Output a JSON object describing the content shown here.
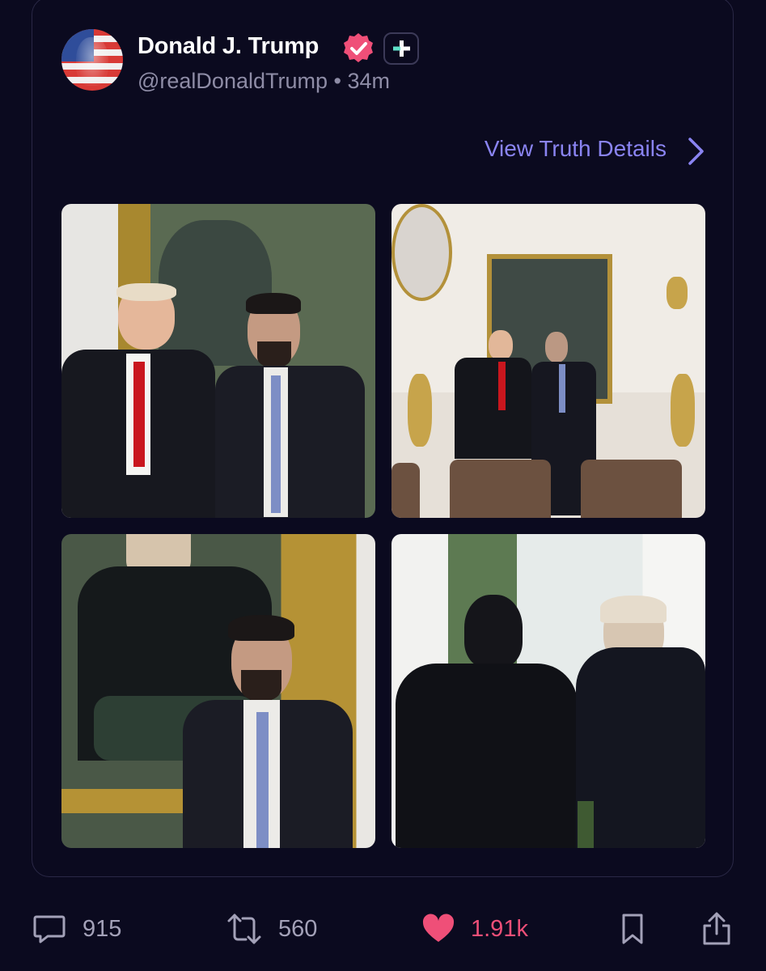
{
  "post": {
    "author_name": "Donald J. Trump",
    "handle": "@realDonaldTrump",
    "separator": "•",
    "time": "34m",
    "view_details_label": "View Truth Details"
  },
  "colors": {
    "background": "#0b0a1f",
    "accent": "#8a84f2",
    "verified": "#ef4f78",
    "like": "#ef4f78",
    "muted": "#a3a1b8"
  },
  "media": [
    {
      "kind": "photo"
    },
    {
      "kind": "photo"
    },
    {
      "kind": "photo"
    },
    {
      "kind": "photo"
    }
  ],
  "actions": {
    "replies": "915",
    "reposts": "560",
    "likes": "1.91k",
    "like_state": "liked",
    "icons": [
      "comment-icon",
      "repost-icon",
      "heart-icon",
      "bookmark-icon",
      "share-icon"
    ]
  }
}
